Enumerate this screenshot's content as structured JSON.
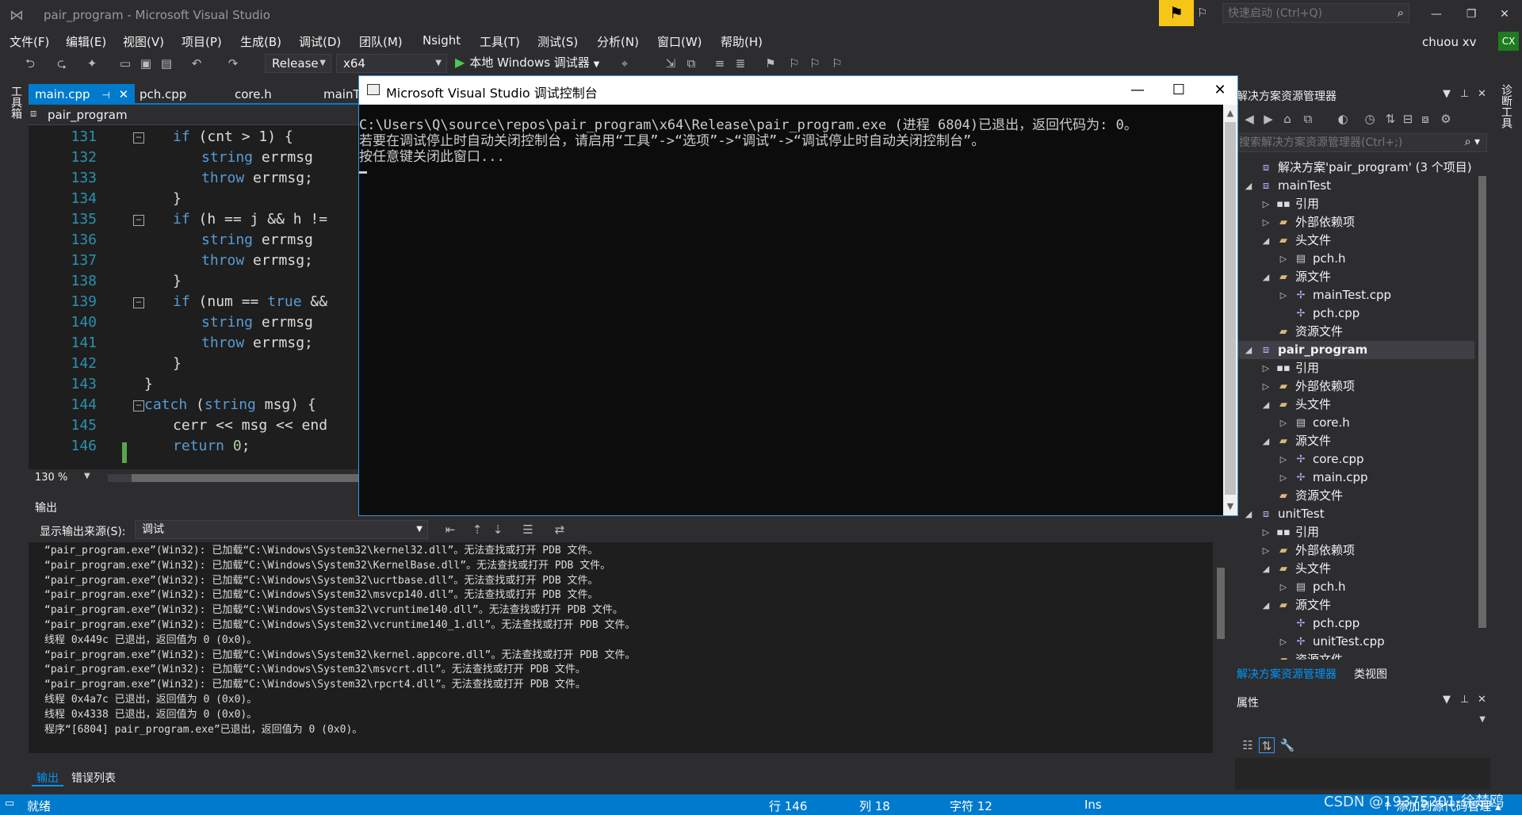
{
  "window": {
    "title": "pair_program - Microsoft Visual Studio",
    "quick_launch_placeholder": "快速启动 (Ctrl+Q)",
    "user_name": "chuou xv",
    "user_initials": "CX"
  },
  "menu": [
    "文件(F)",
    "编辑(E)",
    "视图(V)",
    "项目(P)",
    "生成(B)",
    "调试(D)",
    "团队(M)",
    "Nsight",
    "工具(T)",
    "测试(S)",
    "分析(N)",
    "窗口(W)",
    "帮助(H)"
  ],
  "toolbar": {
    "configuration": "Release",
    "platform": "x64",
    "run_label": "本地 Windows 调试器"
  },
  "left_tab": "工具箱",
  "right_tab": "诊断工具",
  "editor": {
    "tabs": [
      {
        "label": "main.cpp",
        "active": true
      },
      {
        "label": "pch.cpp",
        "active": false
      },
      {
        "label": "core.h",
        "active": false
      },
      {
        "label": "mainT",
        "active": false
      }
    ],
    "scope": "pair_program",
    "zoom": "130 %",
    "lines": [
      {
        "num": "131",
        "fold": true,
        "indent": 2,
        "tokens": [
          [
            "kw",
            "if"
          ],
          [
            "",
            "(cnt > 1) {"
          ]
        ]
      },
      {
        "num": "132",
        "fold": false,
        "indent": 3,
        "tokens": [
          [
            "ty",
            "string"
          ],
          [
            "",
            "errmsg"
          ]
        ]
      },
      {
        "num": "133",
        "fold": false,
        "indent": 3,
        "tokens": [
          [
            "kw",
            "throw"
          ],
          [
            "",
            "errmsg;"
          ]
        ]
      },
      {
        "num": "134",
        "fold": false,
        "indent": 2,
        "tokens": [
          [
            "",
            "}"
          ]
        ]
      },
      {
        "num": "135",
        "fold": true,
        "indent": 2,
        "tokens": [
          [
            "kw",
            "if"
          ],
          [
            "",
            "(h == j && h !="
          ]
        ]
      },
      {
        "num": "136",
        "fold": false,
        "indent": 3,
        "tokens": [
          [
            "ty",
            "string"
          ],
          [
            "",
            "errmsg"
          ]
        ]
      },
      {
        "num": "137",
        "fold": false,
        "indent": 3,
        "tokens": [
          [
            "kw",
            "throw"
          ],
          [
            "",
            "errmsg;"
          ]
        ]
      },
      {
        "num": "138",
        "fold": false,
        "indent": 2,
        "tokens": [
          [
            "",
            "}"
          ]
        ]
      },
      {
        "num": "139",
        "fold": true,
        "indent": 2,
        "tokens": [
          [
            "kw",
            "if"
          ],
          [
            "",
            "(num == "
          ],
          [
            "kw",
            "true"
          ],
          [
            "",
            " &&"
          ]
        ]
      },
      {
        "num": "140",
        "fold": false,
        "indent": 3,
        "tokens": [
          [
            "ty",
            "string"
          ],
          [
            "",
            "errmsg"
          ]
        ]
      },
      {
        "num": "141",
        "fold": false,
        "indent": 3,
        "tokens": [
          [
            "kw",
            "throw"
          ],
          [
            "",
            "errmsg;"
          ]
        ]
      },
      {
        "num": "142",
        "fold": false,
        "indent": 2,
        "tokens": [
          [
            "",
            "}"
          ]
        ]
      },
      {
        "num": "143",
        "fold": false,
        "indent": 1,
        "tokens": [
          [
            "",
            "}"
          ]
        ]
      },
      {
        "num": "144",
        "fold": true,
        "indent": 1,
        "tokens": [
          [
            "kw",
            "catch"
          ],
          [
            "",
            " ("
          ],
          [
            "ty",
            "string"
          ],
          [
            "",
            " msg) {"
          ]
        ]
      },
      {
        "num": "145",
        "fold": false,
        "indent": 2,
        "tokens": [
          [
            "",
            "cerr << msg << end"
          ]
        ]
      },
      {
        "num": "146",
        "fold": false,
        "indent": 2,
        "tokens": [
          [
            "kw",
            "return"
          ],
          [
            "",
            " "
          ],
          [
            "num",
            "0"
          ],
          [
            "",
            ";"
          ]
        ]
      }
    ]
  },
  "console": {
    "title": "Microsoft Visual Studio 调试控制台",
    "lines": [
      "C:\\Users\\Q\\source\\repos\\pair_program\\x64\\Release\\pair_program.exe (进程 6804)已退出，返回代码为: 0。",
      "若要在调试停止时自动关闭控制台，请启用“工具”->“选项”->“调试”->“调试停止时自动关闭控制台”。",
      "按任意键关闭此窗口..."
    ]
  },
  "output": {
    "title": "输出",
    "source_label": "显示输出来源(S):",
    "source_value": "调试",
    "lines": [
      "“pair_program.exe”(Win32): 已加载“C:\\Windows\\System32\\kernel32.dll”。无法查找或打开 PDB 文件。",
      "“pair_program.exe”(Win32): 已加载“C:\\Windows\\System32\\KernelBase.dll”。无法查找或打开 PDB 文件。",
      "“pair_program.exe”(Win32): 已加载“C:\\Windows\\System32\\ucrtbase.dll”。无法查找或打开 PDB 文件。",
      "“pair_program.exe”(Win32): 已加载“C:\\Windows\\System32\\msvcp140.dll”。无法查找或打开 PDB 文件。",
      "“pair_program.exe”(Win32): 已加载“C:\\Windows\\System32\\vcruntime140.dll”。无法查找或打开 PDB 文件。",
      "“pair_program.exe”(Win32): 已加载“C:\\Windows\\System32\\vcruntime140_1.dll”。无法查找或打开 PDB 文件。",
      "线程 0x449c 已退出，返回值为 0 (0x0)。",
      "“pair_program.exe”(Win32): 已加载“C:\\Windows\\System32\\kernel.appcore.dll”。无法查找或打开 PDB 文件。",
      "“pair_program.exe”(Win32): 已加载“C:\\Windows\\System32\\msvcrt.dll”。无法查找或打开 PDB 文件。",
      "“pair_program.exe”(Win32): 已加载“C:\\Windows\\System32\\rpcrt4.dll”。无法查找或打开 PDB 文件。",
      "线程 0x4a7c 已退出，返回值为 0 (0x0)。",
      "线程 0x4338 已退出，返回值为 0 (0x0)。",
      "程序“[6804] pair_program.exe”已退出，返回值为 0 (0x0)。"
    ],
    "tabs": [
      {
        "label": "输出",
        "active": true
      },
      {
        "label": "错误列表",
        "active": false
      }
    ]
  },
  "solution_explorer": {
    "title": "解决方案资源管理器",
    "search_placeholder": "搜索解决方案资源管理器(Ctrl+;)",
    "nodes": [
      {
        "label": "解决方案'pair_program' (3 个项目)",
        "level": 0,
        "expand": "",
        "icon": "solution",
        "selected": false,
        "bold": false
      },
      {
        "label": "mainTest",
        "level": 0,
        "expand": "open",
        "icon": "project",
        "selected": false,
        "bold": false
      },
      {
        "label": "引用",
        "level": 1,
        "expand": "closed",
        "icon": "references",
        "selected": false,
        "bold": false
      },
      {
        "label": "外部依赖项",
        "level": 1,
        "expand": "closed",
        "icon": "folder-ext",
        "selected": false,
        "bold": false
      },
      {
        "label": "头文件",
        "level": 1,
        "expand": "open",
        "icon": "folder",
        "selected": false,
        "bold": false
      },
      {
        "label": "pch.h",
        "level": 2,
        "expand": "closed",
        "icon": "header",
        "selected": false,
        "bold": false
      },
      {
        "label": "源文件",
        "level": 1,
        "expand": "open",
        "icon": "folder",
        "selected": false,
        "bold": false
      },
      {
        "label": "mainTest.cpp",
        "level": 2,
        "expand": "closed",
        "icon": "cpp",
        "selected": false,
        "bold": false
      },
      {
        "label": "pch.cpp",
        "level": 2,
        "expand": "",
        "icon": "cpp",
        "selected": false,
        "bold": false
      },
      {
        "label": "资源文件",
        "level": 1,
        "expand": "",
        "icon": "folder",
        "selected": false,
        "bold": false
      },
      {
        "label": "pair_program",
        "level": 0,
        "expand": "open",
        "icon": "project",
        "selected": true,
        "bold": true
      },
      {
        "label": "引用",
        "level": 1,
        "expand": "closed",
        "icon": "references",
        "selected": false,
        "bold": false
      },
      {
        "label": "外部依赖项",
        "level": 1,
        "expand": "closed",
        "icon": "folder-ext",
        "selected": false,
        "bold": false
      },
      {
        "label": "头文件",
        "level": 1,
        "expand": "open",
        "icon": "folder",
        "selected": false,
        "bold": false
      },
      {
        "label": "core.h",
        "level": 2,
        "expand": "closed",
        "icon": "header",
        "selected": false,
        "bold": false
      },
      {
        "label": "源文件",
        "level": 1,
        "expand": "open",
        "icon": "folder",
        "selected": false,
        "bold": false
      },
      {
        "label": "core.cpp",
        "level": 2,
        "expand": "closed",
        "icon": "cpp",
        "selected": false,
        "bold": false
      },
      {
        "label": "main.cpp",
        "level": 2,
        "expand": "closed",
        "icon": "cpp",
        "selected": false,
        "bold": false
      },
      {
        "label": "资源文件",
        "level": 1,
        "expand": "",
        "icon": "folder",
        "selected": false,
        "bold": false
      },
      {
        "label": "unitTest",
        "level": 0,
        "expand": "open",
        "icon": "project",
        "selected": false,
        "bold": false
      },
      {
        "label": "引用",
        "level": 1,
        "expand": "closed",
        "icon": "references",
        "selected": false,
        "bold": false
      },
      {
        "label": "外部依赖项",
        "level": 1,
        "expand": "closed",
        "icon": "folder-ext",
        "selected": false,
        "bold": false
      },
      {
        "label": "头文件",
        "level": 1,
        "expand": "open",
        "icon": "folder",
        "selected": false,
        "bold": false
      },
      {
        "label": "pch.h",
        "level": 2,
        "expand": "closed",
        "icon": "header",
        "selected": false,
        "bold": false
      },
      {
        "label": "源文件",
        "level": 1,
        "expand": "open",
        "icon": "folder",
        "selected": false,
        "bold": false
      },
      {
        "label": "pch.cpp",
        "level": 2,
        "expand": "",
        "icon": "cpp",
        "selected": false,
        "bold": false
      },
      {
        "label": "unitTest.cpp",
        "level": 2,
        "expand": "closed",
        "icon": "cpp",
        "selected": false,
        "bold": false
      },
      {
        "label": "资源文件",
        "level": 1,
        "expand": "",
        "icon": "folder",
        "selected": false,
        "bold": false
      }
    ],
    "tabs": [
      {
        "label": "解决方案资源管理器",
        "active": true
      },
      {
        "label": "类视图",
        "active": false
      }
    ]
  },
  "properties": {
    "title": "属性"
  },
  "status": {
    "ready": "就绪",
    "line": "行 146",
    "col": "列 18",
    "char": "字符 12",
    "mode": "Ins",
    "source_control": "添加到源代码管理"
  },
  "watermark": "CSDN @19375201-徐楚鸥",
  "colors": {
    "accent": "#007acc",
    "keyword": "#569cd6",
    "line_number": "#2b91af",
    "feedback": "#f5c518"
  }
}
